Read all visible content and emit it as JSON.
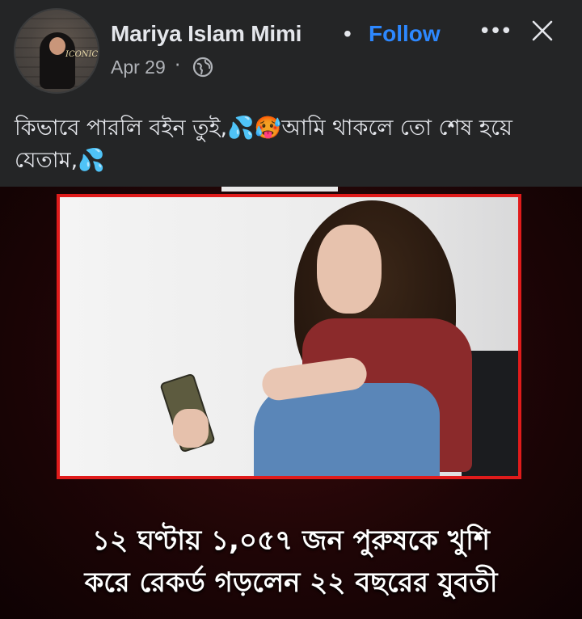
{
  "post": {
    "author": "Mariya Islam Mimi",
    "separator": "•",
    "follow_label": "Follow",
    "more_label": "•••",
    "date": "Apr 29",
    "date_separator": "·",
    "avatar_tag": "ICONIC",
    "caption": "কিভাবে পারলি বইন তুই,💦🥵আমি থাকলে তো শেষ হয়ে যেতাম,💦"
  },
  "image": {
    "headline_line1": "১২ ঘণ্টায় ১,০৫৭ জন পুরুষকে খুশি",
    "headline_line2": "করে রেকর্ড গড়লেন ২২ বছরের যুবতী"
  },
  "colors": {
    "background": "#242526",
    "text": "#e4e6eb",
    "secondary_text": "#b0b3b8",
    "follow_accent": "#2d88ff",
    "frame_red": "#e01b1b"
  },
  "icons": {
    "more": "more-options-icon",
    "close": "close-icon",
    "audience": "globe-icon"
  }
}
